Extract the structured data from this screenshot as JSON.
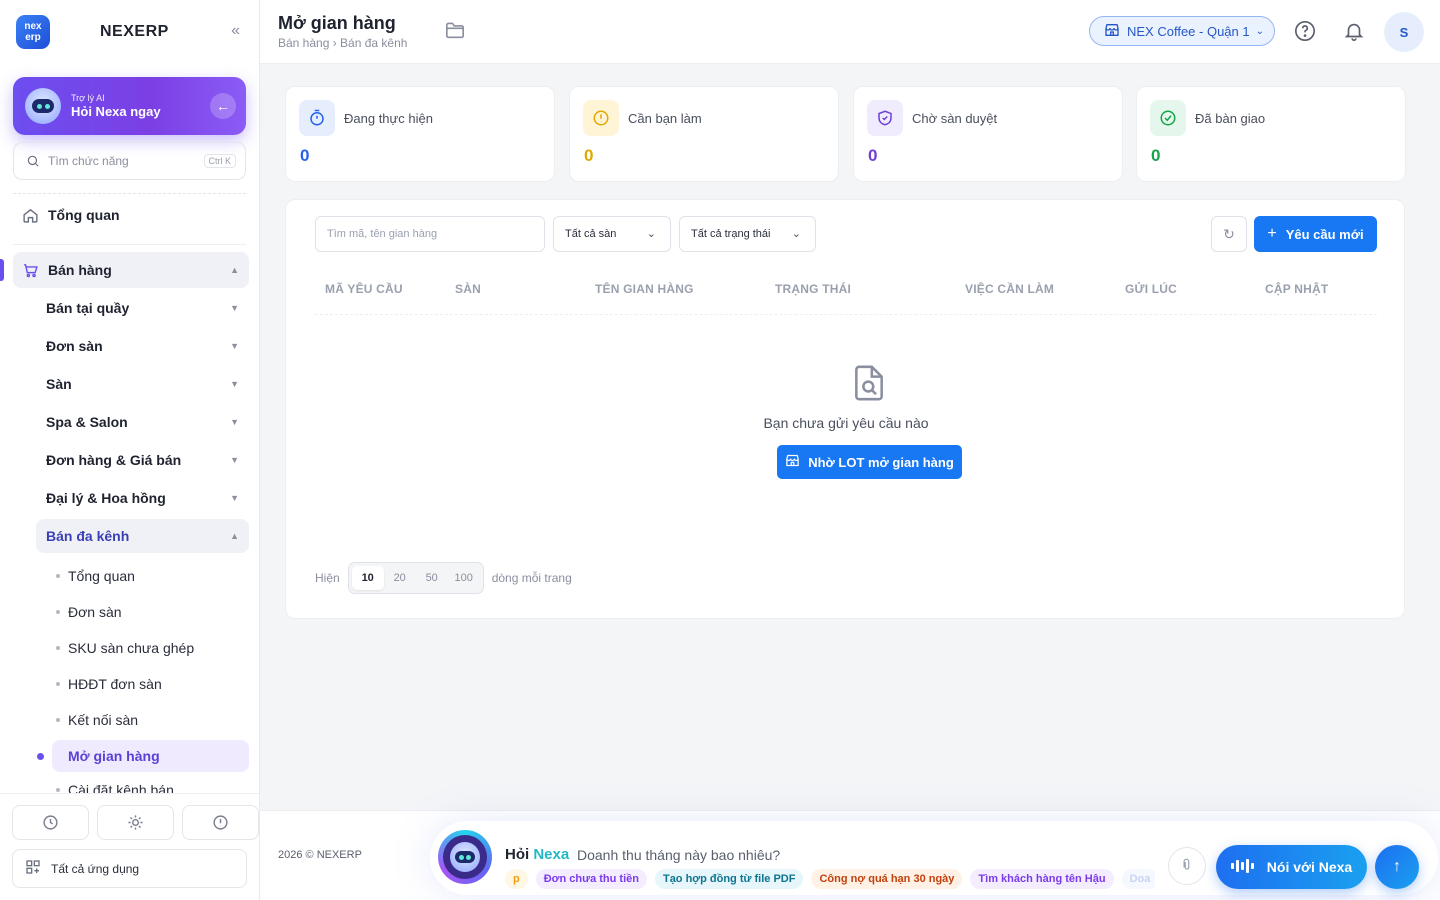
{
  "app": {
    "brand": "NEXERP",
    "logo_top": "nex",
    "logo_bottom": "erp"
  },
  "ai_card": {
    "subtitle": "Trợ lý AI",
    "title": "Hỏi Nexa ngay"
  },
  "search": {
    "placeholder": "Tìm chức năng",
    "shortcut": "Ctrl K"
  },
  "nav": {
    "overview": "Tổng quan",
    "group": "Bán hàng",
    "subs": [
      "Bán tại quầy",
      "Đơn sàn",
      "Sàn",
      "Spa & Salon",
      "Đơn hàng & Giá bán",
      "Đại lý & Hoa hồng",
      "Bán đa kênh"
    ],
    "leaves": [
      "Tổng quan",
      "Đơn sàn",
      "SKU sàn chưa ghép",
      "HĐĐT đơn sàn",
      "Kết nối sàn",
      "Mở gian hàng",
      "Cài đặt kênh bán"
    ],
    "all_apps": "Tất cả ứng dụng"
  },
  "header": {
    "title": "Mở gian hàng",
    "breadcrumb": "Bán hàng › Bán đa kênh",
    "store": "NEX Coffee - Quận 1",
    "avatar": "S"
  },
  "stats": [
    {
      "label": "Đang thực hiện",
      "value": "0",
      "color": "#2563eb"
    },
    {
      "label": "Cần bạn làm",
      "value": "0",
      "color": "#e0a800"
    },
    {
      "label": "Chờ sàn duyệt",
      "value": "0",
      "color": "#6d3fd6"
    },
    {
      "label": "Đã bàn giao",
      "value": "0",
      "color": "#16a34a"
    }
  ],
  "toolbar": {
    "search_placeholder": "Tìm mã, tên gian hàng",
    "filter_platform": "Tất cả sàn",
    "filter_status": "Tất cả trạng thái",
    "new_request": "Yêu cầu mới"
  },
  "table": {
    "columns": [
      "MÃ YÊU CẦU",
      "SÀN",
      "TÊN GIAN HÀNG",
      "TRẠNG THÁI",
      "VIỆC CẦN LÀM",
      "GỬI LÚC",
      "CẬP NHẬT"
    ],
    "rows": []
  },
  "empty": {
    "message": "Bạn chưa gửi yêu cầu nào",
    "cta": "Nhờ LOT mở gian hàng"
  },
  "pager": {
    "show_label": "Hiện",
    "sizes": [
      "10",
      "20",
      "50",
      "100"
    ],
    "selected": "10",
    "per_page_label": "dòng mỗi trang"
  },
  "footer": {
    "copyright": "2026 © NEXERP",
    "ask_prefix": "Hỏi",
    "ask_name": "Nexa",
    "ask_question": "Doanh thu tháng này bao nhiêu?",
    "chips": [
      {
        "text": "p",
        "color": "#f59e0b",
        "bg": "#fff7e6"
      },
      {
        "text": "Đơn chưa thu tiền",
        "color": "#7c3aed",
        "bg": "#f3edff"
      },
      {
        "text": "Tạo hợp đồng từ file PDF",
        "color": "#0e7490",
        "bg": "#e6f6fb"
      },
      {
        "text": "Công nợ quá hạn 30 ngày",
        "color": "#c2410c",
        "bg": "#fff1e6"
      },
      {
        "text": "Tìm khách hàng tên Hậu",
        "color": "#7c3aed",
        "bg": "#f3edff"
      },
      {
        "text": "Doa",
        "color": "#c8d4f0",
        "bg": "#f5f8ff"
      }
    ],
    "talk_button": "Nói với Nexa"
  }
}
